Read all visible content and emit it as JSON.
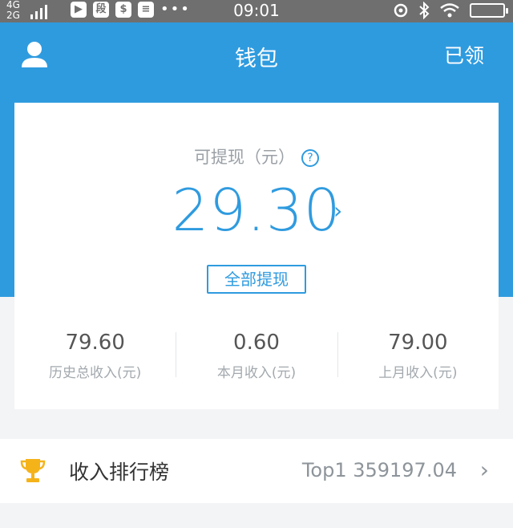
{
  "status_bar": {
    "network_top": "4G",
    "network_bottom": "2G",
    "time": "09:01",
    "more_dots": "•••"
  },
  "header": {
    "title": "钱包",
    "claimed_link": "已领"
  },
  "balance": {
    "label": "可提现（元）",
    "help_icon": "?",
    "amount": "29.30",
    "withdraw_all_button": "全部提现"
  },
  "stats": [
    {
      "value": "79.60",
      "label": "历史总收入(元)"
    },
    {
      "value": "0.60",
      "label": "本月收入(元)"
    },
    {
      "value": "79.00",
      "label": "上月收入(元)"
    }
  ],
  "ranking": {
    "label": "收入排行榜",
    "value": "Top1 359197.04"
  },
  "colors": {
    "brand_blue": "#2f9bdf",
    "trophy_gold": "#f5b31a"
  }
}
